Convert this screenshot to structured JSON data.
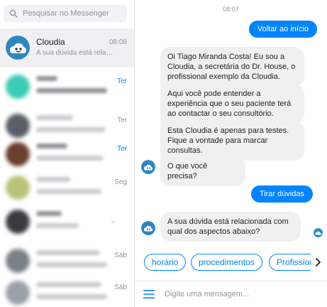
{
  "search": {
    "placeholder": "Pesquisar no Messenger"
  },
  "conversations": [
    {
      "name": "Cloudia",
      "snippet": "A sua dúvida está relacionada com",
      "time": "08:08",
      "active": true
    },
    {
      "time": "Ter",
      "unread": true
    },
    {
      "time": "Ter"
    },
    {
      "time": "Ter",
      "unread": true
    },
    {
      "time": "Seg"
    },
    {
      "time": ""
    },
    {
      "time": "Sáb"
    },
    {
      "time": "Sáb"
    }
  ],
  "chat": {
    "timestamp": "08:07",
    "messages": {
      "out_1": "Voltar ao início",
      "in_1": "Oi Tiago Miranda Costa! Eu sou a Cloudia, a secretária do Dr. House, o profissional exemplo da Cloudia.",
      "in_2": "Aqui você pode entender a experiência que o seu paciente terá ao contactar o seu consultório.",
      "in_3": "Esta Cloudia é apenas para testes. Fique a vontade para marcar consultas.",
      "in_4": "O que você precisa?",
      "out_2": "Tirar dúvidas",
      "in_5": "A sua dúvida está relacionada com qual dos aspectos abaixo?"
    },
    "quick_replies": [
      "horário",
      "procedimentos",
      "Profissionais"
    ],
    "composer_placeholder": "Digite uma mensagem..."
  },
  "colors": {
    "accent": "#0084ff",
    "bubble_in": "#f1f0f0",
    "bot_avatar": "#2e86c1"
  },
  "icons": [
    "search-icon",
    "menu-icon",
    "chevron-right-icon",
    "seen-avatar-icon",
    "cloudia-bot-icon"
  ]
}
